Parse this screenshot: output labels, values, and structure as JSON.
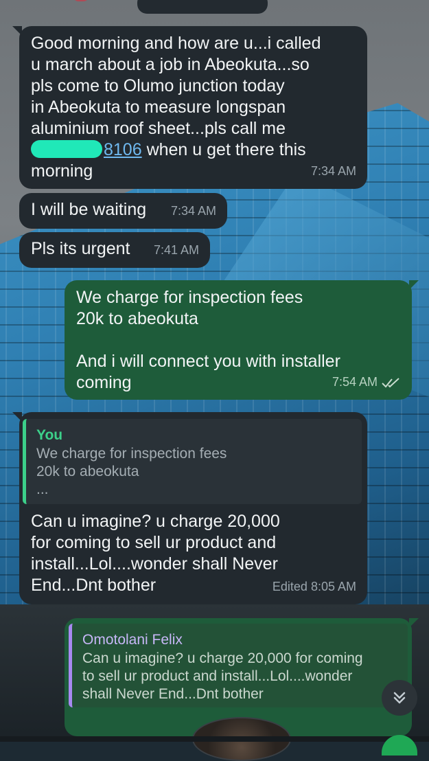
{
  "messages": [
    {
      "id": "m1",
      "direction": "incoming",
      "text_before_link": "Good morning and how are u...i called\nu march about a job in Abeokuta...so\npls come to Olumo junction today\nin Abeokuta to measure longspan\naluminium roof sheet...pls call me\n",
      "phone_suffix": "8106",
      "text_after_link": " when u get there this\nmorning",
      "time": "7:34 AM"
    },
    {
      "id": "m2",
      "direction": "incoming",
      "text": "I will be waiting",
      "time": "7:34 AM"
    },
    {
      "id": "m3",
      "direction": "incoming",
      "text": "Pls its urgent",
      "time": "7:41 AM"
    },
    {
      "id": "m4",
      "direction": "outgoing",
      "text": "We charge for inspection fees\n20k to abeokuta\n\nAnd i will connect you with installer\ncoming",
      "time": "7:54 AM",
      "status": "read"
    },
    {
      "id": "m5",
      "direction": "incoming",
      "quote": {
        "author": "You",
        "text": "We charge for inspection fees\n20k to abeokuta\n..."
      },
      "text": "Can u imagine? u charge 20,000\nfor coming to sell ur product and\ninstall...Lol....wonder shall Never\nEnd...Dnt bother",
      "edited_label": "Edited",
      "time": "8:05 AM"
    },
    {
      "id": "m6",
      "direction": "outgoing",
      "quote": {
        "author": "Omotolani Felix",
        "text": "Can u imagine? u charge 20,000 for coming\nto sell ur product and install...Lol....wonder\nshall Never End...Dnt bother"
      }
    }
  ],
  "icons": {
    "read_receipt": "double-check-icon",
    "scroll_down": "chevron-double-down-icon"
  },
  "colors": {
    "incoming_bubble": "#22292f",
    "outgoing_bubble": "#1e5c3a",
    "link": "#6fb8ef",
    "quote_accent_you": "#3cd08a",
    "quote_accent_other": "#a789f0"
  }
}
